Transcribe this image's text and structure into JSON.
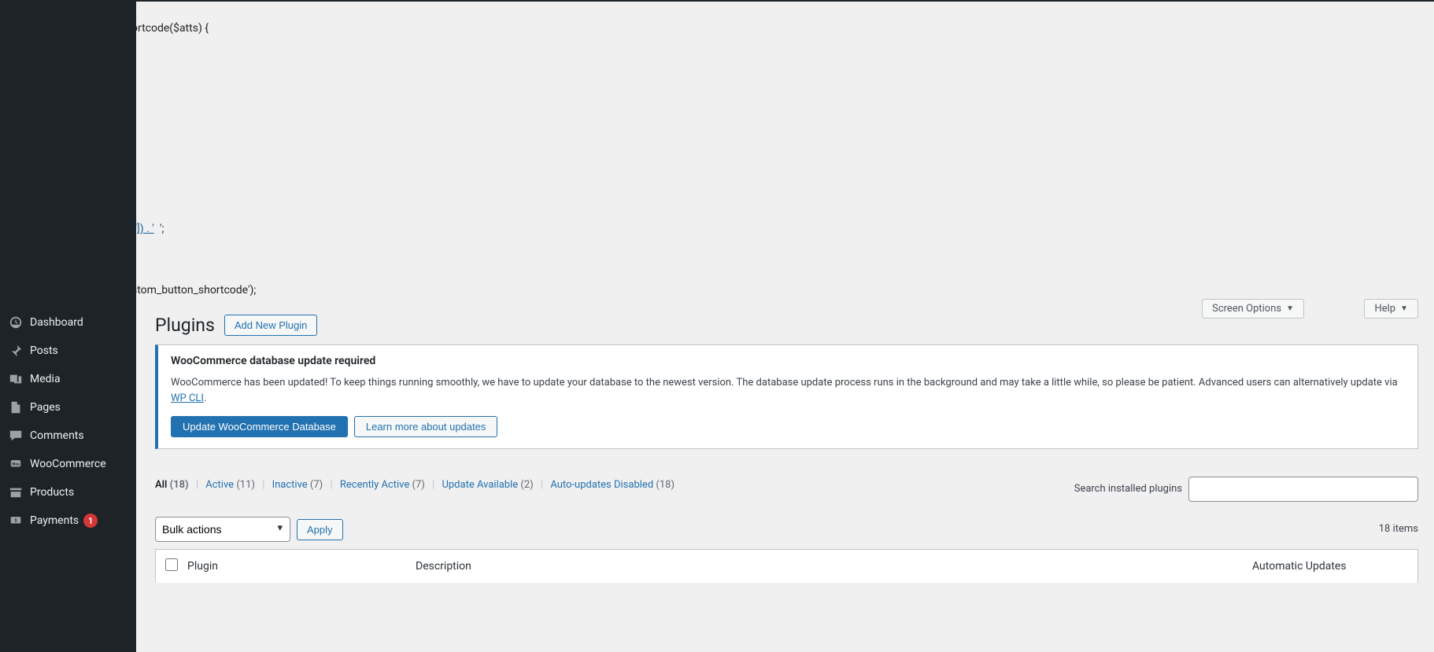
{
  "sidebar": {
    "items": [
      {
        "label": "Dashboard"
      },
      {
        "label": "Posts"
      },
      {
        "label": "Media"
      },
      {
        "label": "Pages"
      },
      {
        "label": "Comments"
      },
      {
        "label": "WooCommerce"
      },
      {
        "label": "Products"
      },
      {
        "label": "Payments",
        "badge": "1"
      }
    ]
  },
  "leaked": {
    "l1": "ortcode($atts) {",
    "l2": "/",
    "l3": "t']) . '",
    "l3b": "';",
    "l4": "stom_button_shortcode');"
  },
  "tabs": {
    "screen_options": "Screen Options",
    "help": "Help"
  },
  "header": {
    "title": "Plugins",
    "add_new": "Add New Plugin"
  },
  "notice": {
    "title": "WooCommerce database update required",
    "body_part1": "WooCommerce has been updated! To keep things running smoothly, we have to update your database to the newest version. The database update process runs in the background and may take a little while, so please be patient. Advanced users can alternatively update via ",
    "body_link_text": "WP CLI",
    "body_part2": ".",
    "update_btn": "Update WooCommerce Database",
    "learn_more": "Learn more about updates"
  },
  "filters": {
    "all_label": "All",
    "all_count": "(18)",
    "active_label": "Active",
    "active_count": "(11)",
    "inactive_label": "Inactive",
    "inactive_count": "(7)",
    "recently_active_label": "Recently Active",
    "recently_active_count": "(7)",
    "update_available_label": "Update Available",
    "update_available_count": "(2)",
    "auto_disabled_label": "Auto-updates Disabled",
    "auto_disabled_count": "(18)"
  },
  "search": {
    "label": "Search installed plugins",
    "value": ""
  },
  "bulk": {
    "selected": "Bulk actions",
    "apply": "Apply"
  },
  "items_count": "18 items",
  "table": {
    "col_plugin": "Plugin",
    "col_desc": "Description",
    "col_auto": "Automatic Updates"
  }
}
